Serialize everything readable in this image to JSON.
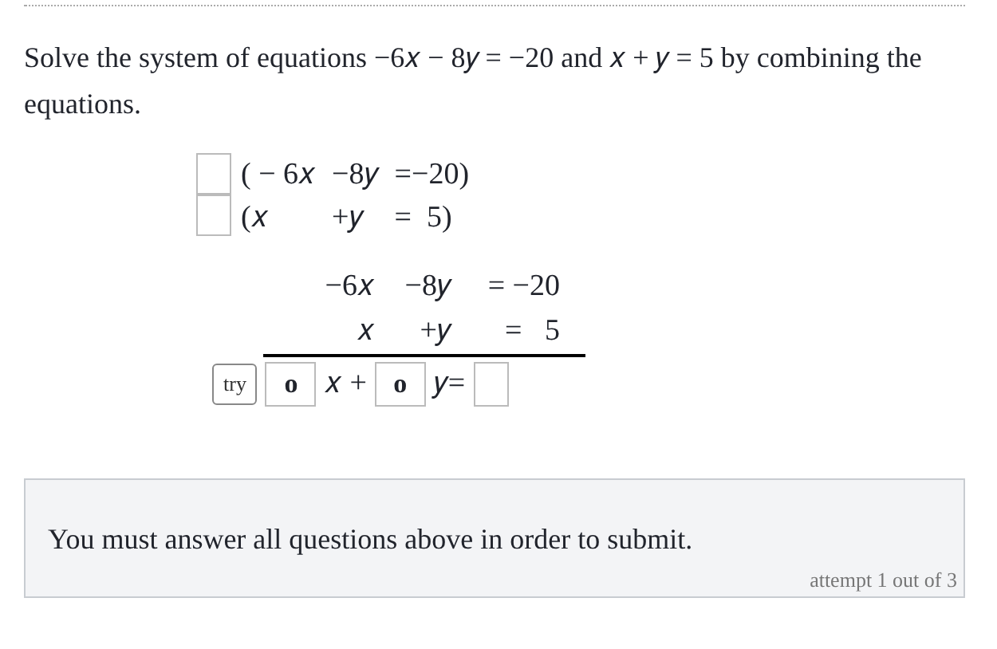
{
  "question": "Solve the system of equations −6𝑥 − 8𝑦 = −20 and 𝑥 + 𝑦 = 5 by combining the equations.",
  "system_rows": [
    {
      "cells": [
        "( − 6𝑥",
        "−8𝑦",
        "=−20)"
      ]
    },
    {
      "cells": [
        "(𝑥",
        "+𝑦",
        "=  5)"
      ]
    }
  ],
  "sum_rows": [
    {
      "cells": [
        "−6𝑥",
        "−8𝑦",
        "= −20"
      ]
    },
    {
      "cells": [
        "𝑥",
        "+𝑦",
        "=   5"
      ]
    }
  ],
  "answer_row": {
    "try_button": "try",
    "x_coefficient": "o",
    "x_label": "𝑥 +",
    "y_coefficient": "o",
    "y_label": "𝑦="
  },
  "footer": {
    "message": "You must answer all questions above in order to submit.",
    "attempt": "attempt 1 out of 3"
  }
}
